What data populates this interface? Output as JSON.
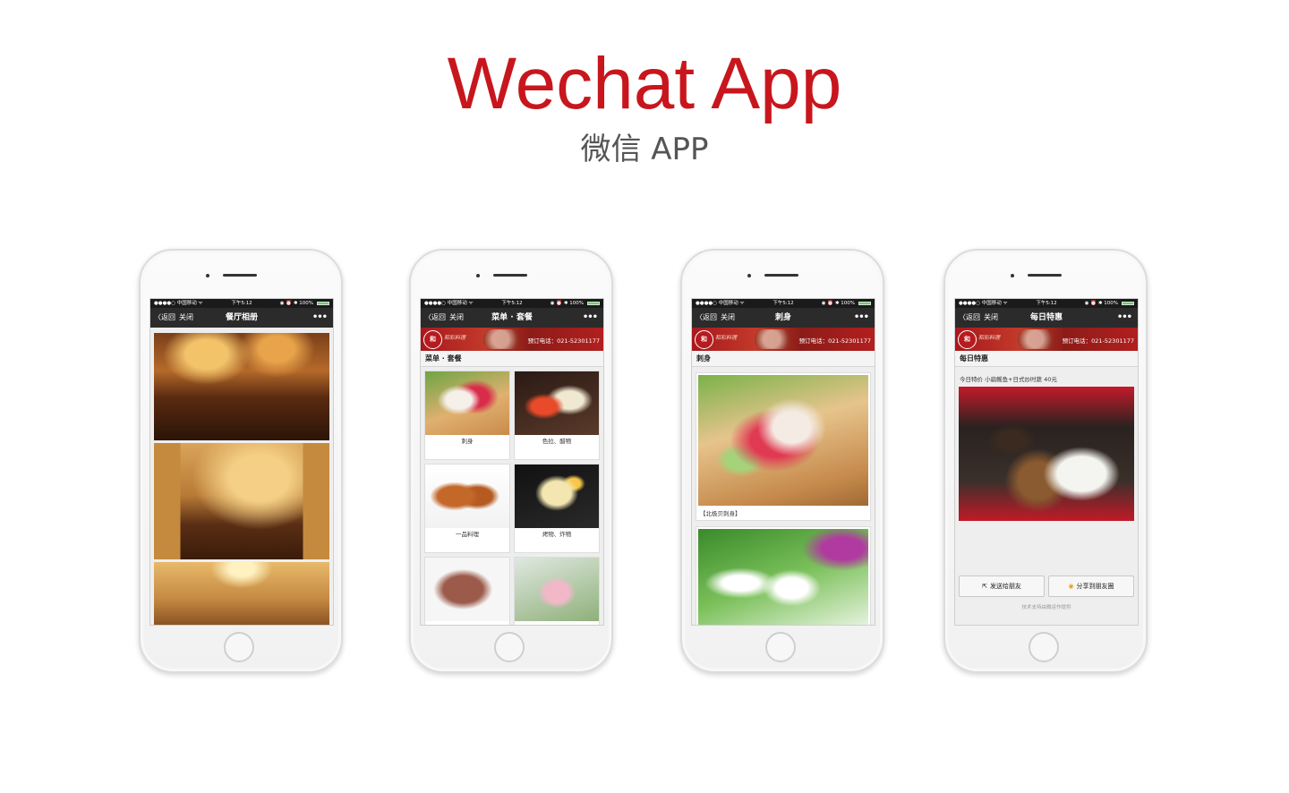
{
  "header": {
    "title": "Wechat App",
    "subtitle": "微信 APP"
  },
  "status": {
    "carrier": "●●●●○ 中国移动 ᯤ",
    "time": "下午5:12",
    "battery": "◉ ⏰ ✱ 100%"
  },
  "nav": {
    "back": "〈返回",
    "close": "关闭",
    "more": "•••"
  },
  "banner": {
    "logo": "和",
    "brand": "和彩料理",
    "phone": "预订电话：021-52301177"
  },
  "screens": {
    "album": {
      "title": "餐厅相册"
    },
    "menu": {
      "title": "菜单 · 套餐",
      "section": "菜单 · 套餐",
      "items": [
        "刺身",
        "色拉、醋物",
        "一品料理",
        "烤物、炸物",
        "",
        ""
      ]
    },
    "sashimi": {
      "title": "刺身",
      "section": "刺身",
      "caption1": "【北极贝刺身】"
    },
    "special": {
      "title": "每日特惠",
      "section": "每日特惠",
      "text": "今日特价 小扁鳐鱼+日式炒时蔬 40元",
      "share_friend": "发送给朋友",
      "share_moments": "分享到朋友圈",
      "footer": "技术支持由微运作提供"
    }
  },
  "colors": {
    "accent": "#c8161d",
    "navbar": "#2b2b2b"
  }
}
